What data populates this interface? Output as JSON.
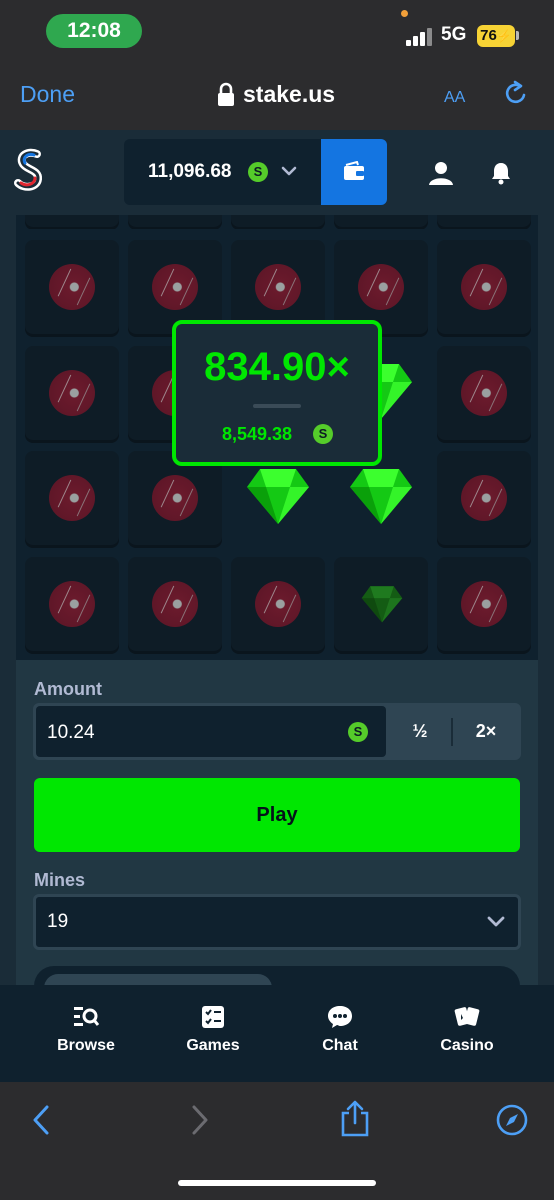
{
  "status_bar": {
    "time": "12:08",
    "network": "5G",
    "battery": "76"
  },
  "browser": {
    "done_label": "Done",
    "url": "stake.us",
    "text_size_label": "AA"
  },
  "header": {
    "balance": "11,096.68",
    "currency_icon": "S",
    "wallet_icon": "wallet-icon"
  },
  "game": {
    "rows": [
      [
        "mine",
        "mine",
        "mine",
        "mine",
        "mine"
      ],
      [
        "mine",
        "mine",
        "gem",
        "gem",
        "mine"
      ],
      [
        "mine",
        "mine",
        "gem",
        "gem",
        "mine"
      ],
      [
        "mine",
        "mine",
        "mine",
        "gem-dim",
        "mine"
      ]
    ],
    "win_multiplier": "834.90×",
    "win_amount": "8,549.38",
    "win_currency": "S"
  },
  "controls": {
    "amount_label": "Amount",
    "amount_value": "10.24",
    "amount_currency": "S",
    "half_label": "½",
    "double_label": "2×",
    "play_label": "Play",
    "mines_label": "Mines",
    "mines_value": "19"
  },
  "bottom_nav": {
    "items": [
      {
        "label": "Browse",
        "icon": "browse-icon"
      },
      {
        "label": "Games",
        "icon": "games-icon"
      },
      {
        "label": "Chat",
        "icon": "chat-icon"
      },
      {
        "label": "Casino",
        "icon": "casino-icon"
      }
    ]
  },
  "colors": {
    "accent_green": "#00e701",
    "brand_blue": "#1475e1",
    "bg_dark": "#0f212e",
    "bg_mid": "#1a2c38"
  }
}
